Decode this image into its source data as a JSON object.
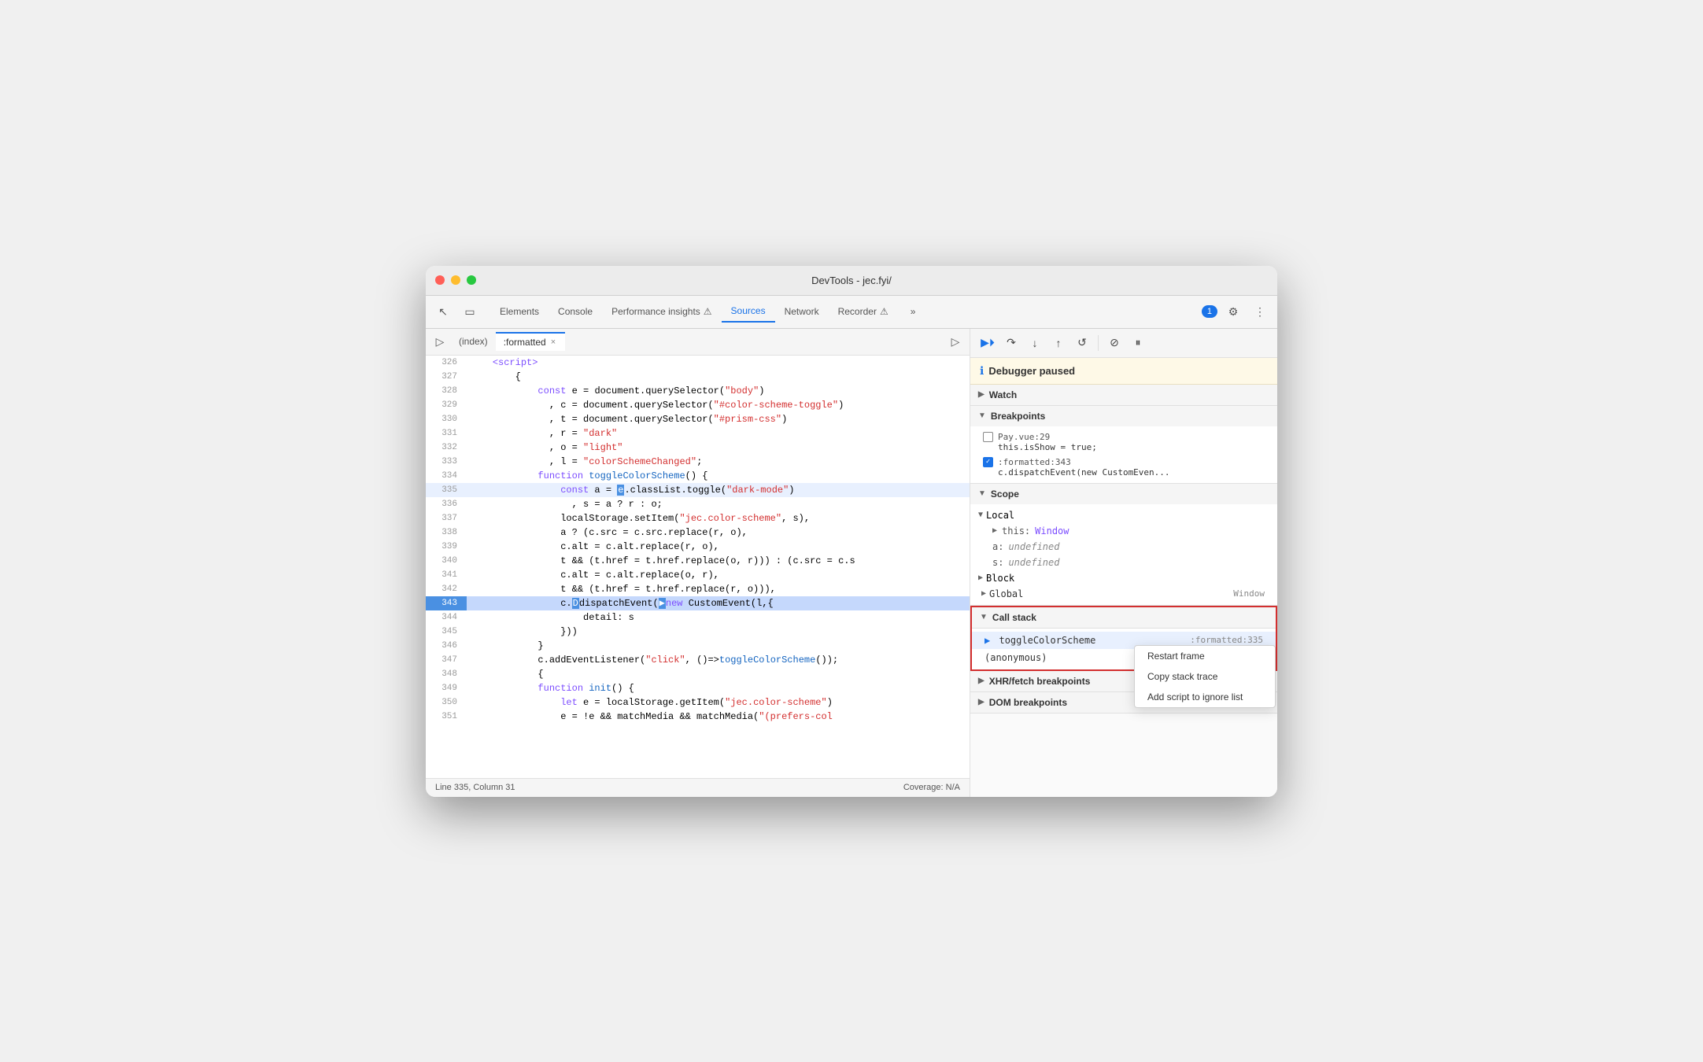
{
  "window": {
    "title": "DevTools - jec.fyi/"
  },
  "tabs": {
    "items": [
      {
        "label": "Elements",
        "active": false
      },
      {
        "label": "Console",
        "active": false
      },
      {
        "label": "Performance insights",
        "active": false,
        "icon": "⚠"
      },
      {
        "label": "Sources",
        "active": true
      },
      {
        "label": "Network",
        "active": false
      },
      {
        "label": "Recorder",
        "active": false,
        "icon": "⚠"
      }
    ],
    "more_label": "»",
    "chat_badge": "1"
  },
  "source_tabs": {
    "index_label": "(index)",
    "formatted_label": ":formatted",
    "close_label": "×"
  },
  "code": {
    "lines": [
      {
        "num": "326",
        "content": "    <script>",
        "type": "tag"
      },
      {
        "num": "327",
        "content": "        {",
        "type": "normal"
      },
      {
        "num": "328",
        "content": "            const e = document.querySelector(\"body\")",
        "type": "normal"
      },
      {
        "num": "329",
        "content": "              , c = document.querySelector(\"#color-scheme-toggle\")",
        "type": "normal"
      },
      {
        "num": "330",
        "content": "              , t = document.querySelector(\"#prism-css\")",
        "type": "normal"
      },
      {
        "num": "331",
        "content": "              , r = \"dark\"",
        "type": "normal"
      },
      {
        "num": "332",
        "content": "              , o = \"light\"",
        "type": "normal"
      },
      {
        "num": "333",
        "content": "              , l = \"colorSchemeChanged\";",
        "type": "normal"
      },
      {
        "num": "334",
        "content": "            function toggleColorScheme() {",
        "type": "normal"
      },
      {
        "num": "335",
        "content": "                const a = e.classList.toggle(\"dark-mode\")",
        "type": "highlighted"
      },
      {
        "num": "336",
        "content": "                  , s = a ? r : o;",
        "type": "normal"
      },
      {
        "num": "337",
        "content": "                localStorage.setItem(\"jec.color-scheme\", s),",
        "type": "normal"
      },
      {
        "num": "338",
        "content": "                a ? (c.src = c.src.replace(r, o),",
        "type": "normal"
      },
      {
        "num": "339",
        "content": "                c.alt = c.alt.replace(r, o),",
        "type": "normal"
      },
      {
        "num": "340",
        "content": "                t && (t.href = t.href.replace(o, r))) : (c.src = c.s",
        "type": "normal"
      },
      {
        "num": "341",
        "content": "                c.alt = c.alt.replace(o, r),",
        "type": "normal"
      },
      {
        "num": "342",
        "content": "                t && (t.href = t.href.replace(r, o))),",
        "type": "normal"
      },
      {
        "num": "343",
        "content": "                c.dispatchEvent(new CustomEvent(l,{",
        "type": "current"
      },
      {
        "num": "344",
        "content": "                    detail: s",
        "type": "normal"
      },
      {
        "num": "345",
        "content": "                }))",
        "type": "normal"
      },
      {
        "num": "346",
        "content": "            }",
        "type": "normal"
      },
      {
        "num": "347",
        "content": "            c.addEventListener(\"click\", ()=>toggleColorScheme());",
        "type": "normal"
      },
      {
        "num": "348",
        "content": "            {",
        "type": "normal"
      },
      {
        "num": "349",
        "content": "            function init() {",
        "type": "normal"
      },
      {
        "num": "350",
        "content": "                let e = localStorage.getItem(\"jec.color-scheme\")",
        "type": "normal"
      },
      {
        "num": "351",
        "content": "                e = !e && matchMedia && matchMedia(\"(prefers-col",
        "type": "normal"
      }
    ]
  },
  "status_bar": {
    "position": "Line 335, Column 31",
    "coverage": "Coverage: N/A"
  },
  "debugger": {
    "title": "Debugger paused",
    "watch_label": "Watch",
    "breakpoints_label": "Breakpoints",
    "breakpoints": [
      {
        "checked": false,
        "file": "Pay.vue:29",
        "code": "this.isShow = true;"
      },
      {
        "checked": true,
        "file": ":formatted:343",
        "code": "c.dispatchEvent(new CustomEven..."
      }
    ],
    "scope_label": "Scope",
    "local_label": "Local",
    "this_label": "this",
    "this_value": "Window",
    "a_label": "a",
    "a_value": "undefined",
    "s_label": "s",
    "s_value": "undefined",
    "block_label": "Block",
    "global_label": "Global",
    "global_value": "Window",
    "call_stack_label": "Call stack",
    "call_stack": [
      {
        "active": true,
        "func": "toggleColorScheme",
        "location": ":formatted:335"
      },
      {
        "active": false,
        "func": "(anonymous)",
        "location": ""
      }
    ],
    "context_menu": {
      "items": [
        "Restart frame",
        "Copy stack trace",
        "Add script to ignore list"
      ]
    },
    "xhr_label": "XHR/fetch breakpoints",
    "dom_label": "DOM breakpoints"
  },
  "icons": {
    "cursor": "↖",
    "device": "▭",
    "play": "▶",
    "resume": "⏵",
    "step_over": "↷",
    "step_into": "↓",
    "step_out": "↑",
    "restart": "↺",
    "deactivate": "⊘",
    "pause": "⏸",
    "chevron_right": "▶",
    "chevron_down": "▼",
    "settings": "⚙",
    "more": "⋮",
    "close": "×",
    "navigate": "▷"
  }
}
